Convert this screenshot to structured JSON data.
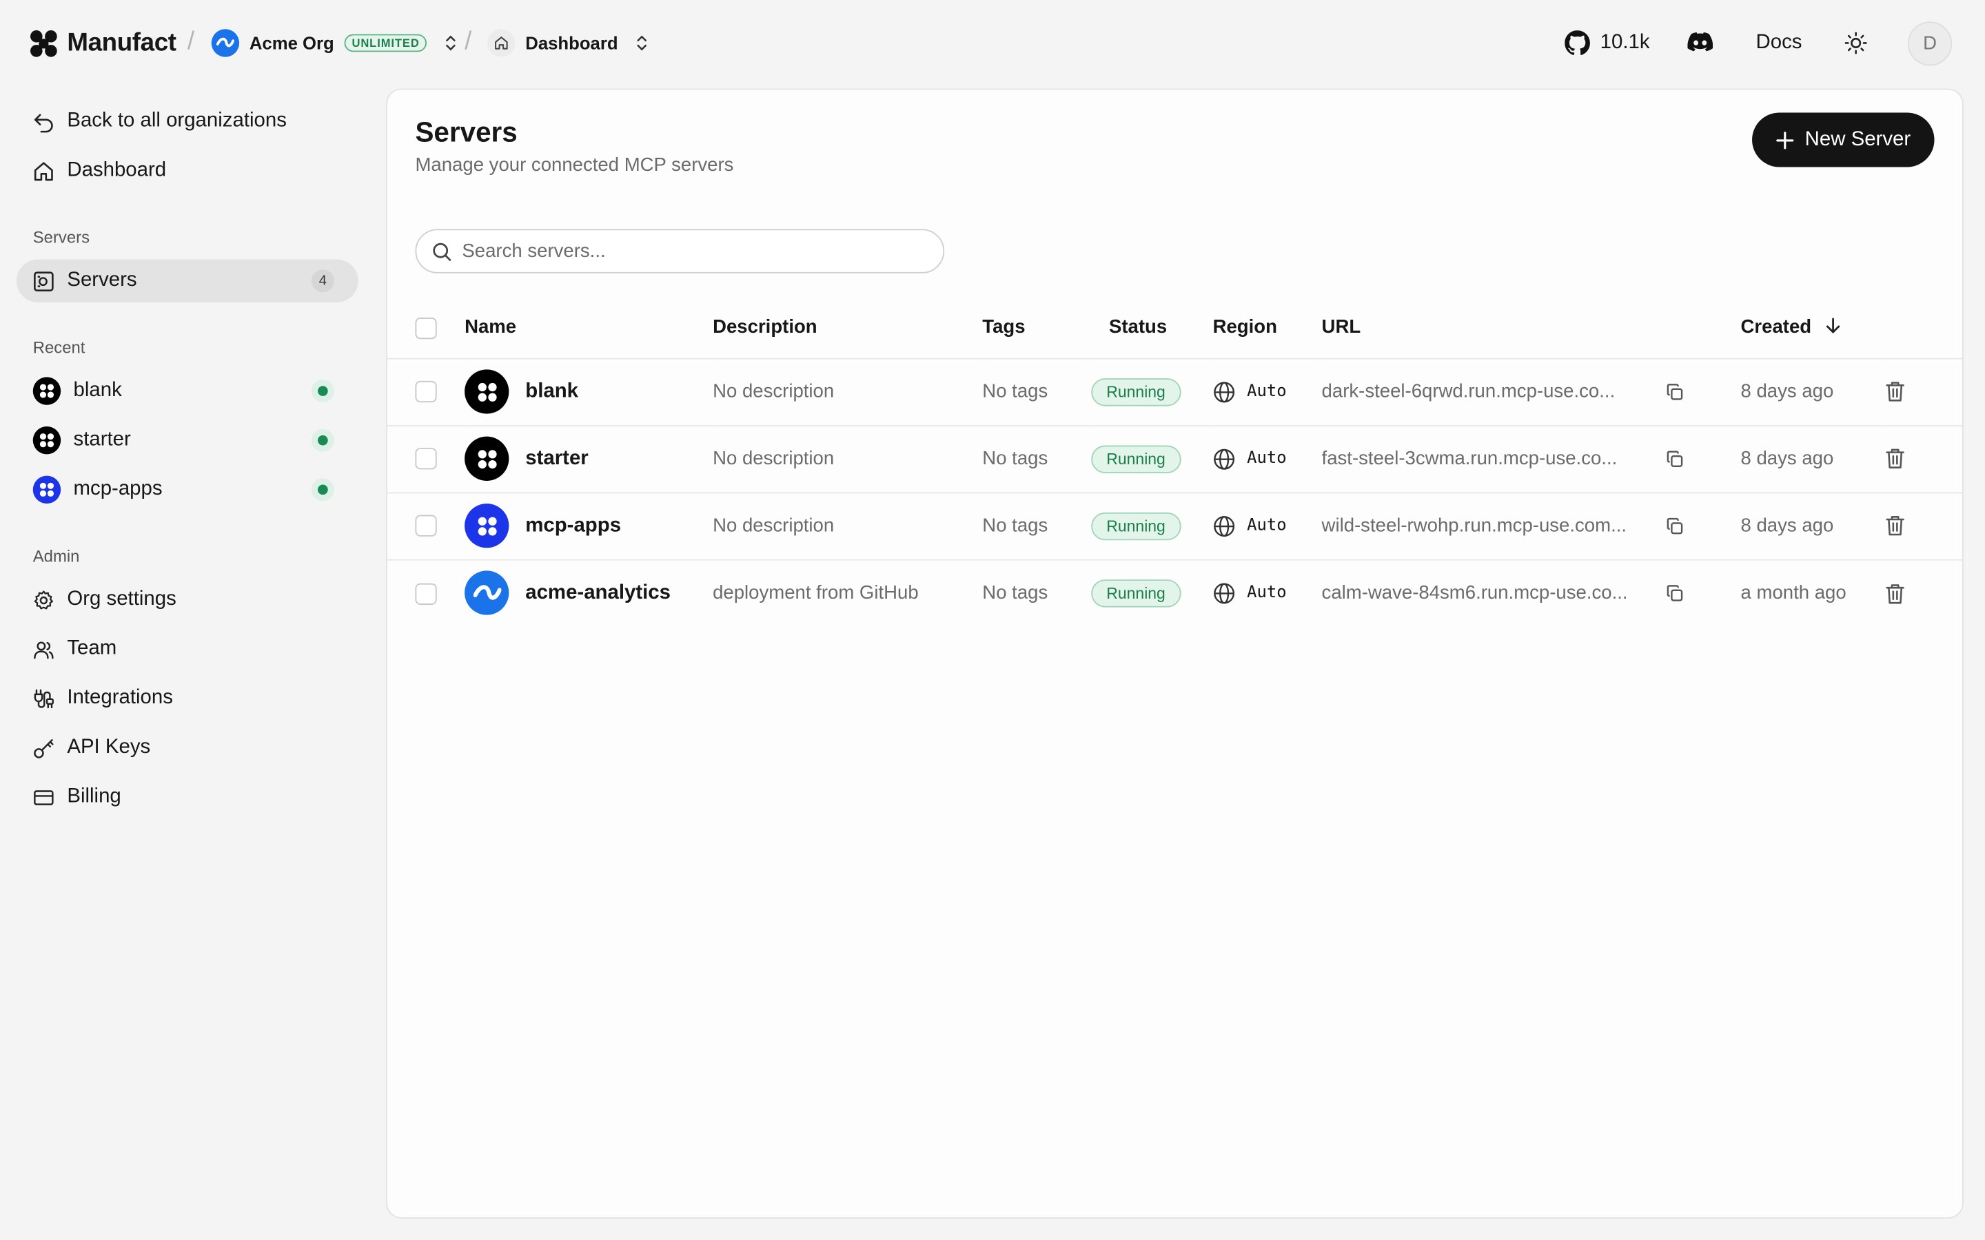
{
  "header": {
    "brand": "Manufact",
    "org_name": "Acme Org",
    "org_plan_badge": "UNLIMITED",
    "page_crumb": "Dashboard",
    "github_stars": "10.1k",
    "docs_label": "Docs",
    "user_initial": "D"
  },
  "sidebar": {
    "back_label": "Back to all organizations",
    "dashboard_label": "Dashboard",
    "servers_section": "Servers",
    "servers_item": {
      "label": "Servers",
      "count": "4"
    },
    "recent_section": "Recent",
    "recent": [
      {
        "label": "blank",
        "status": "running"
      },
      {
        "label": "starter",
        "status": "running"
      },
      {
        "label": "mcp-apps",
        "status": "running"
      }
    ],
    "admin_section": "Admin",
    "admin": [
      {
        "label": "Org settings",
        "icon": "gear-icon"
      },
      {
        "label": "Team",
        "icon": "users-icon"
      },
      {
        "label": "Integrations",
        "icon": "plug-icon"
      },
      {
        "label": "API Keys",
        "icon": "key-icon"
      },
      {
        "label": "Billing",
        "icon": "credit-card-icon"
      }
    ]
  },
  "main": {
    "title": "Servers",
    "subtitle": "Manage your connected MCP servers",
    "new_button": "New Server",
    "search_placeholder": "Search servers...",
    "columns": [
      "Name",
      "Description",
      "Tags",
      "Status",
      "Region",
      "URL",
      "Created"
    ],
    "rows": [
      {
        "name": "blank",
        "description": "No description",
        "tags": "No tags",
        "status": "Running",
        "region": "Auto",
        "url": "dark-steel-6qrwd.run.mcp-use.co...",
        "created": "8 days ago"
      },
      {
        "name": "starter",
        "description": "No description",
        "tags": "No tags",
        "status": "Running",
        "region": "Auto",
        "url": "fast-steel-3cwma.run.mcp-use.co...",
        "created": "8 days ago"
      },
      {
        "name": "mcp-apps",
        "description": "No description",
        "tags": "No tags",
        "status": "Running",
        "region": "Auto",
        "url": "wild-steel-rwohp.run.mcp-use.com...",
        "created": "8 days ago"
      },
      {
        "name": "acme-analytics",
        "description": "deployment from GitHub",
        "tags": "No tags",
        "status": "Running",
        "region": "Auto",
        "url": "calm-wave-84sm6.run.mcp-use.co...",
        "created": "a month ago"
      }
    ]
  },
  "colors": {
    "accent_dark": "#141414",
    "running_green": "#1a7f4b",
    "org_blue": "#1a73e8",
    "mcp_apps_blue": "#1d35e8"
  }
}
